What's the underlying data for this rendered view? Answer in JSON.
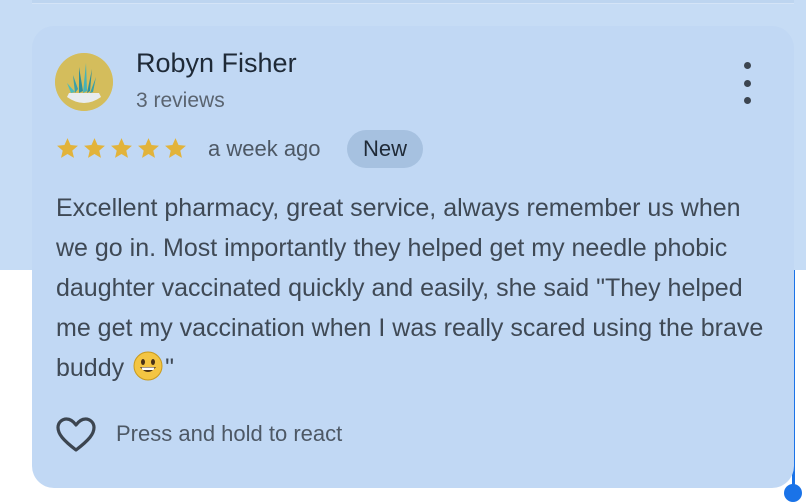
{
  "review": {
    "author_name": "Robyn Fisher",
    "author_reviews": "3 reviews",
    "rating": 5,
    "rating_max": 5,
    "time_ago": "a week ago",
    "badge": "New",
    "text_before_emoji": "Excellent pharmacy, great service, always remember us when we go in. Most importantly they helped get my needle phobic daughter vaccinated quickly and easily, she said \"They helped me get my vaccination when I was really scared using the brave buddy",
    "text_after_emoji": "\"",
    "emoji": "grinning-face-icon",
    "react_label": "Press and hold to react"
  },
  "colors": {
    "page_background_top": "#c6dcf5",
    "card_background": "#c1d8f4",
    "star": "#e2b33a",
    "badge_background": "#a6c1e0",
    "scrollbar": "#1a73e8"
  },
  "icons": {
    "avatar": "succulent-plant-avatar",
    "more": "more-vertical-icon",
    "star": "star-icon",
    "react": "heart-outline-icon"
  }
}
